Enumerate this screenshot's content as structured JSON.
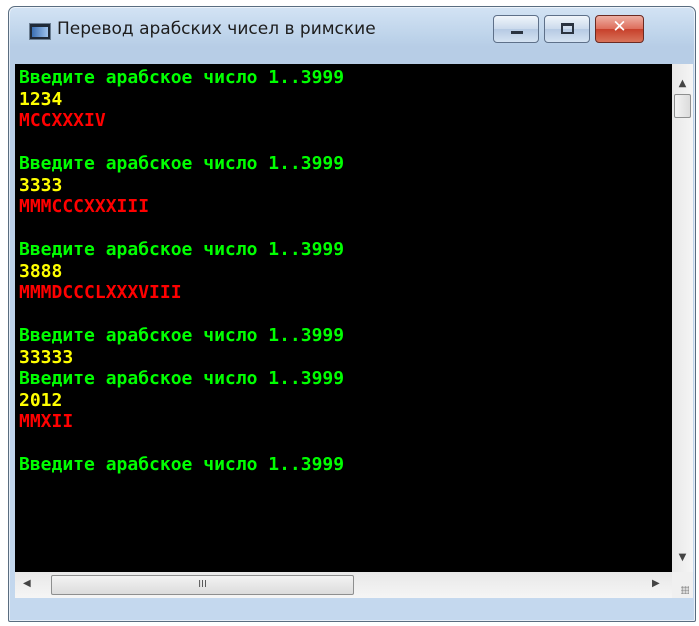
{
  "window": {
    "title": "Перевод арабских чисел в римские",
    "icon": "console-app-icon",
    "controls": [
      "minimize-icon",
      "maximize-icon",
      "close-icon"
    ],
    "close_glyph": "✕"
  },
  "console": {
    "background": "#000000",
    "colors": {
      "prompt": "#00ff00",
      "input": "#ffff00",
      "result": "#ff0000"
    },
    "lines": [
      {
        "kind": "prompt",
        "text": "Введите арабское число 1..3999"
      },
      {
        "kind": "input",
        "text": "1234"
      },
      {
        "kind": "result",
        "text": "MCCXXXIV"
      },
      {
        "kind": "blank",
        "text": ""
      },
      {
        "kind": "prompt",
        "text": "Введите арабское число 1..3999"
      },
      {
        "kind": "input",
        "text": "3333"
      },
      {
        "kind": "result",
        "text": "MMMCCCXXXIII"
      },
      {
        "kind": "blank",
        "text": ""
      },
      {
        "kind": "prompt",
        "text": "Введите арабское число 1..3999"
      },
      {
        "kind": "input",
        "text": "3888"
      },
      {
        "kind": "result",
        "text": "MMMDCCCLXXXVIII"
      },
      {
        "kind": "blank",
        "text": ""
      },
      {
        "kind": "prompt",
        "text": "Введите арабское число 1..3999"
      },
      {
        "kind": "input",
        "text": "33333"
      },
      {
        "kind": "prompt",
        "text": "Введите арабское число 1..3999"
      },
      {
        "kind": "input",
        "text": "2012"
      },
      {
        "kind": "result",
        "text": "MMXII"
      },
      {
        "kind": "blank",
        "text": ""
      },
      {
        "kind": "prompt",
        "text": "Введите арабское число 1..3999"
      }
    ]
  },
  "scrollbars": {
    "vertical": {
      "up": "▲",
      "down": "▼"
    },
    "horizontal": {
      "left": "◀",
      "right": "▶",
      "thumb_grip": "III"
    }
  }
}
